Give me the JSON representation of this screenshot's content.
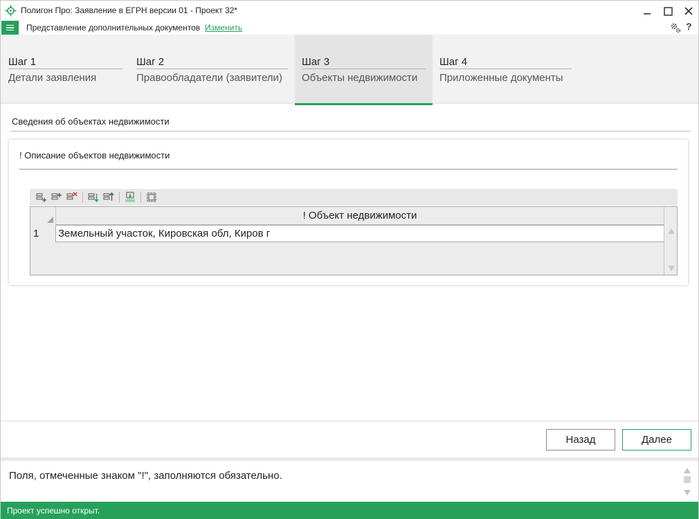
{
  "window": {
    "title": "Полигон Про: Заявление в ЕГРН версии 01 - Проект 32*",
    "minimize_icon": "minimize-icon",
    "maximize_icon": "maximize-icon",
    "close_icon": "close-icon"
  },
  "ribbon": {
    "document_mode": "Представление дополнительных документов",
    "change_link": "Изменить",
    "settings_icon": "gears-icon",
    "help_label": "?"
  },
  "steps": [
    {
      "number": "Шаг 1",
      "label": "Детали заявления",
      "active": false
    },
    {
      "number": "Шаг 2",
      "label": "Правообладатели (заявители)",
      "active": false
    },
    {
      "number": "Шаг 3",
      "label": "Объекты недвижимости",
      "active": true
    },
    {
      "number": "Шаг 4",
      "label": "Приложенные документы",
      "active": false
    }
  ],
  "section": {
    "title": "Сведения об объектах недвижимости"
  },
  "card": {
    "title": "! Описание объектов недвижимости",
    "toolbar": [
      "add-row-icon",
      "insert-row-icon",
      "delete-row-icon",
      "move-down-icon",
      "move-up-icon",
      "import-xml-icon",
      "select-all-icon"
    ],
    "table": {
      "header": "! Объект недвижимости",
      "rows": [
        {
          "num": "1",
          "value": "Земельный участок, Кировская обл, Киров г"
        }
      ]
    }
  },
  "buttons": {
    "back": "Назад",
    "next": "Далее"
  },
  "hint": {
    "text": "Поля, отмеченные знаком \"!\", заполняются обязательно."
  },
  "status": {
    "text": "Проект успешно открыт."
  },
  "colors": {
    "accent": "#27a05a"
  }
}
